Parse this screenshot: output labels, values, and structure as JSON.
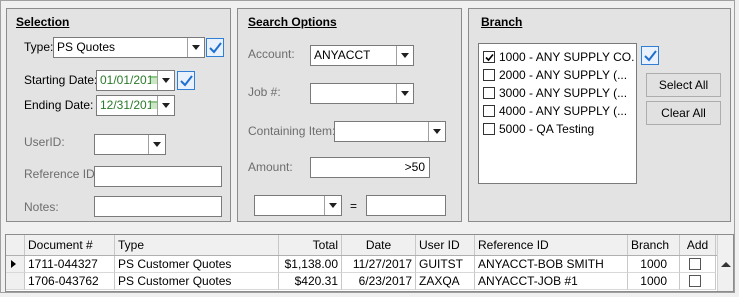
{
  "selection": {
    "title": "Selection",
    "type_label": "Type:",
    "type_value": "PS Quotes",
    "starting_date_label": "Starting Date:",
    "starting_date_value": "01/01/201",
    "ending_date_label": "Ending Date:",
    "ending_date_value": "12/31/201",
    "userid_label": "UserID:",
    "userid_value": "",
    "reference_id_label": "Reference ID:",
    "reference_id_value": "",
    "notes_label": "Notes:",
    "notes_value": ""
  },
  "search_options": {
    "title": "Search Options",
    "account_label": "Account:",
    "account_value": "ANYACCT",
    "job_label": "Job #:",
    "job_value": "",
    "containing_item_label": "Containing Item:",
    "containing_item_value": "",
    "amount_label": "Amount:",
    "amount_value": ">50",
    "operator_value": "",
    "equals_sign": "=",
    "compare_value": ""
  },
  "branch": {
    "title": "Branch",
    "items": [
      {
        "label": "1000 - ANY SUPPLY CO.",
        "checked": true
      },
      {
        "label": "2000 - ANY SUPPLY (...",
        "checked": false
      },
      {
        "label": "3000 - ANY SUPPLY (...",
        "checked": false
      },
      {
        "label": "4000 - ANY SUPPLY (...",
        "checked": false
      },
      {
        "label": "5000 - QA Testing",
        "checked": false
      }
    ],
    "select_all_label": "Select All",
    "clear_all_label": "Clear All"
  },
  "grid": {
    "columns": [
      "Document #",
      "Type",
      "Total",
      "Date",
      "User ID",
      "Reference ID",
      "Branch",
      "Add"
    ],
    "rows": [
      {
        "document": "1711-044327",
        "type": "PS Customer Quotes",
        "total": "$1,138.00",
        "date": "11/27/2017",
        "user_id": "GUITST",
        "reference_id": "ANYACCT-BOB SMITH",
        "branch": "1000",
        "add": false
      },
      {
        "document": "1706-043762",
        "type": "PS Customer Quotes",
        "total": "$420.31",
        "date": "6/23/2017",
        "user_id": "ZAXQA",
        "reference_id": "ANYACCT-JOB #1",
        "branch": "1000",
        "add": false
      }
    ]
  },
  "colors": {
    "check_accent": "#1e6fd0",
    "date_text": "#2a7a2a",
    "panel_bg": "#e3e3e3"
  }
}
